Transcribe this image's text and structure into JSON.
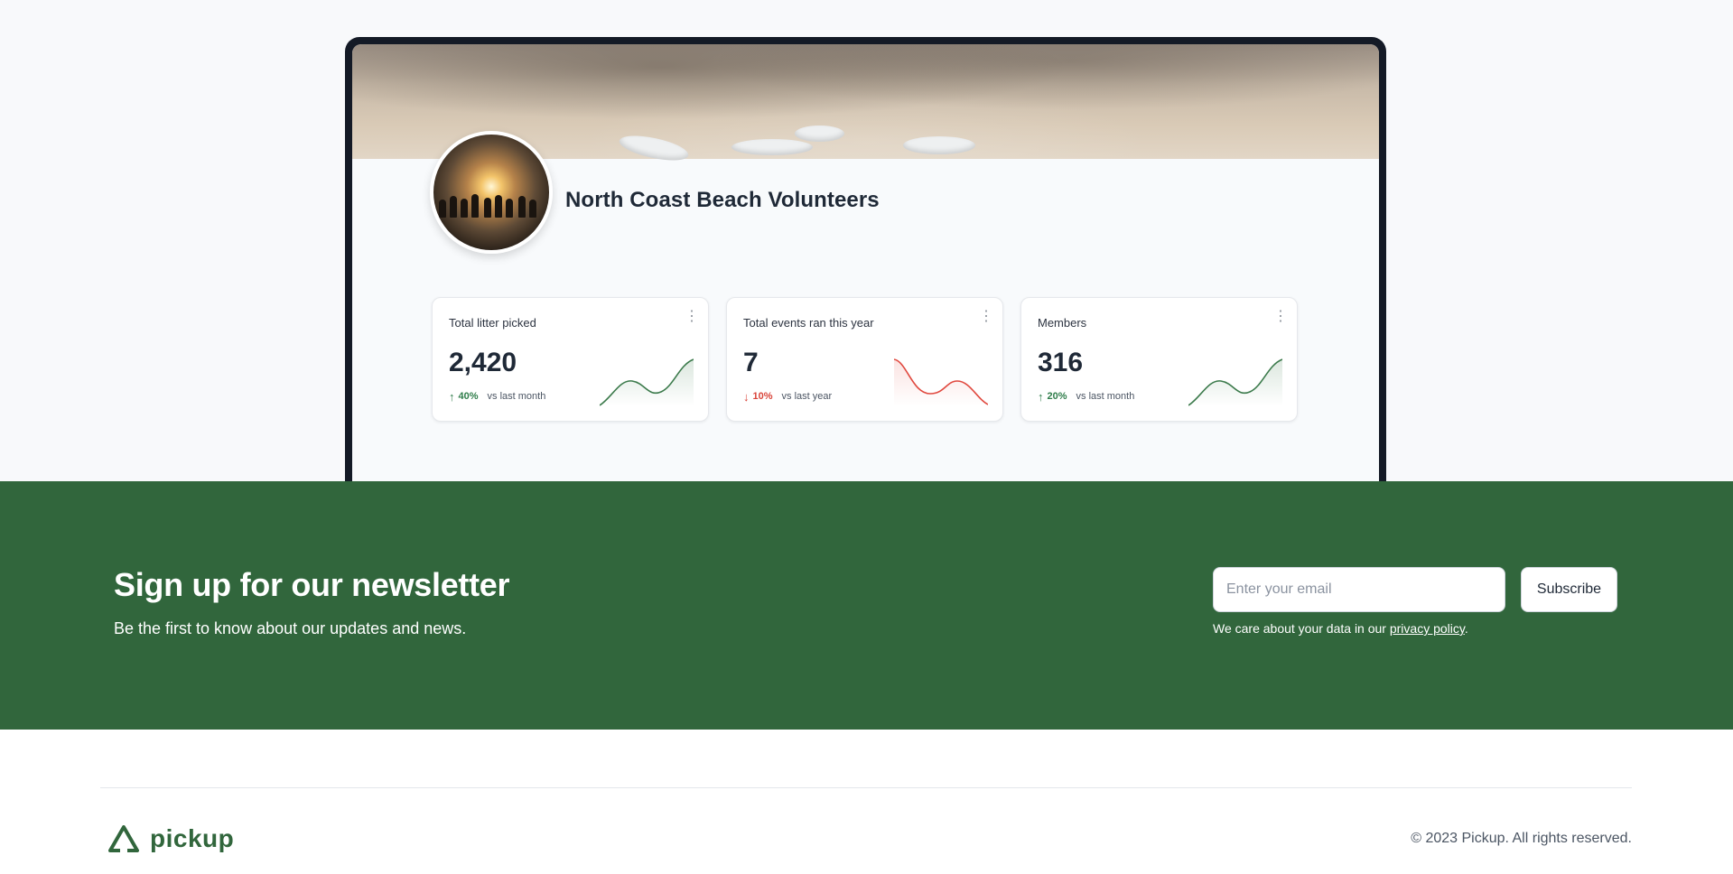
{
  "organization": {
    "name": "North Coast Beach Volunteers"
  },
  "stats": [
    {
      "label": "Total litter picked",
      "value": "2,420",
      "trend": "up",
      "change": "40%",
      "comparison": "vs last month",
      "color": "#3b7a4b"
    },
    {
      "label": "Total events ran this year",
      "value": "7",
      "trend": "down",
      "change": "10%",
      "comparison": "vs last year",
      "color": "#e0483e"
    },
    {
      "label": "Members",
      "value": "316",
      "trend": "up",
      "change": "20%",
      "comparison": "vs last month",
      "color": "#3b7a4b"
    }
  ],
  "newsletter": {
    "title": "Sign up for our newsletter",
    "subtitle": "Be the first to know about our updates and news.",
    "email_placeholder": "Enter your email",
    "subscribe_label": "Subscribe",
    "privacy_prefix": "We care about your data in our ",
    "privacy_link": "privacy policy",
    "privacy_suffix": ".",
    "background": "#31663c"
  },
  "footer": {
    "logo_text": "pickup",
    "copyright": "© 2023 Pickup. All rights reserved."
  },
  "icons": {
    "card_menu": "more-vertical-icon",
    "trend_up": "arrow-up-icon",
    "trend_down": "arrow-down-icon",
    "logo": "recycle-triangle-icon"
  }
}
